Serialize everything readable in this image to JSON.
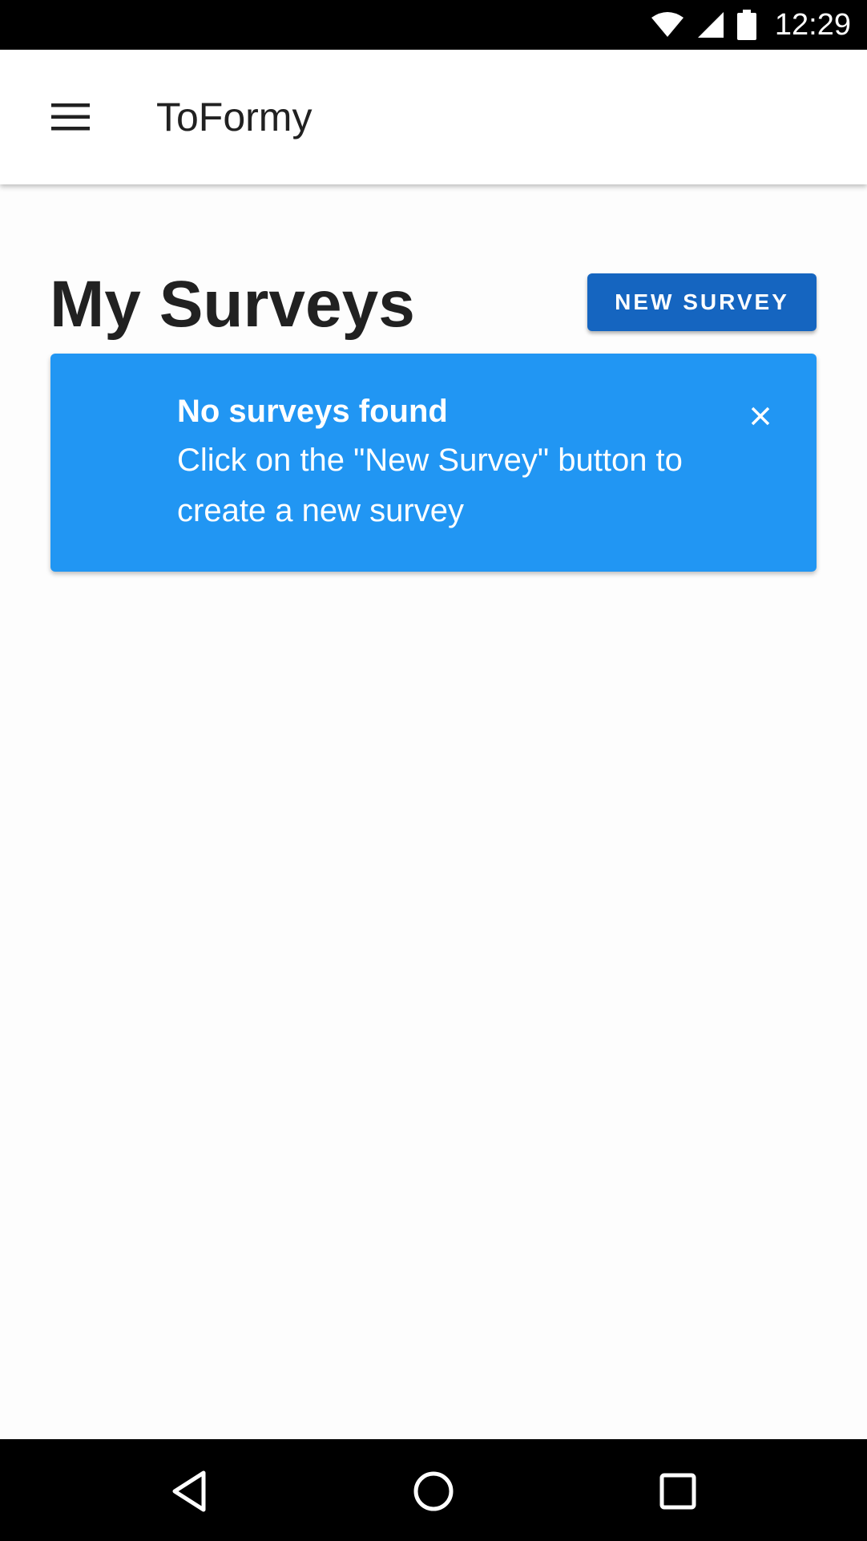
{
  "status_bar": {
    "time": "12:29",
    "icons": [
      "wifi-icon",
      "signal-icon",
      "battery-icon"
    ]
  },
  "app_bar": {
    "title": "ToFormy",
    "menu_icon": "hamburger-menu-icon"
  },
  "main": {
    "heading": "My Surveys",
    "new_survey_label": "NEW SURVEY",
    "alert": {
      "title": "No surveys found",
      "message": "Click on the \"New Survey\" button to create a new survey",
      "close_icon": "close-icon"
    }
  },
  "nav_bar": {
    "icons": [
      "back-icon",
      "home-icon",
      "recents-icon"
    ]
  },
  "colors": {
    "primary_button": "#1565c0",
    "alert_background": "#2196f3",
    "text_dark": "#212121"
  }
}
